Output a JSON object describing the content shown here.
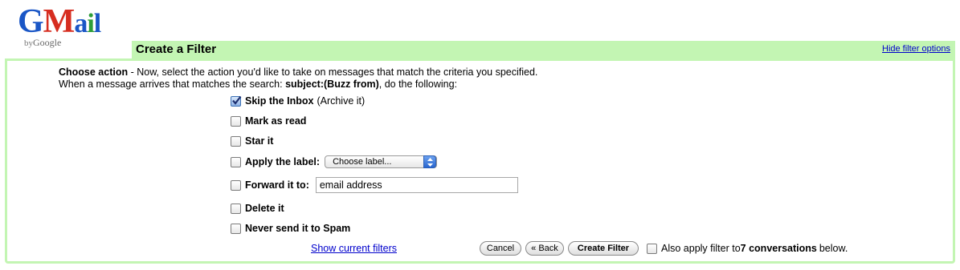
{
  "logo": {
    "letters": [
      "G",
      "M",
      "a",
      "i",
      "l"
    ],
    "by": "by",
    "google": "Google"
  },
  "header": {
    "title": "Create a Filter",
    "hide_link": "Hide filter options"
  },
  "intro": {
    "choose_action_label": "Choose action",
    "choose_action_text": " - Now, select the action you'd like to take on messages that match the criteria you specified.",
    "line2_prefix": "When a message arrives that matches the search: ",
    "search_query": "subject:(Buzz from)",
    "line2_suffix": ", do the following:"
  },
  "actions": {
    "skip_inbox": {
      "label": "Skip the Inbox",
      "note": "(Archive it)",
      "checked": true
    },
    "mark_read": {
      "label": "Mark as read",
      "checked": false
    },
    "star": {
      "label": "Star it",
      "checked": false
    },
    "apply_label": {
      "label": "Apply the label:",
      "select_value": "Choose label...",
      "checked": false
    },
    "forward": {
      "label": "Forward it to:",
      "input_value": "email address",
      "checked": false
    },
    "delete": {
      "label": "Delete it",
      "checked": false
    },
    "never_spam": {
      "label": "Never send it to Spam",
      "checked": false
    }
  },
  "footer": {
    "show_filters_link": "Show current filters",
    "cancel_label": "Cancel",
    "back_label": "« Back",
    "create_label": "Create Filter",
    "also_apply_prefix": "Also apply filter to ",
    "conversation_count": "7 conversations",
    "also_apply_suffix": " below."
  },
  "colors": {
    "header_green": "#c3f5b3",
    "link_blue": "#0000cc"
  }
}
